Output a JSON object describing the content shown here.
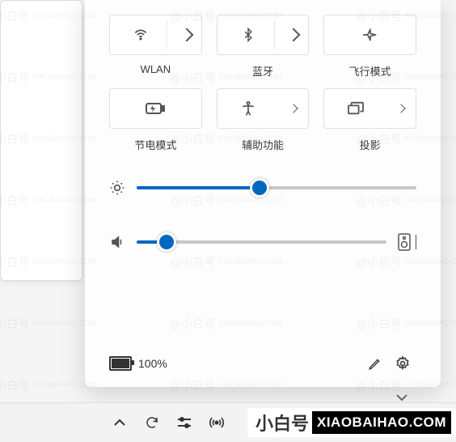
{
  "tiles": {
    "wifi": {
      "label": "WLAN"
    },
    "bluetooth": {
      "label": "蓝牙"
    },
    "airplane": {
      "label": "飞行模式"
    },
    "battery_saver": {
      "label": "节电模式"
    },
    "accessibility": {
      "label": "辅助功能"
    },
    "project": {
      "label": "投影"
    }
  },
  "sliders": {
    "brightness": {
      "percent": 44
    },
    "volume": {
      "percent": 12
    }
  },
  "battery": {
    "label": "100%"
  },
  "watermark": {
    "cn": "@小白号",
    "en": "XIAOBAIHAO.COM"
  },
  "logo": {
    "cn": "小白号",
    "en": "XIAOBAIHAO.COM"
  }
}
